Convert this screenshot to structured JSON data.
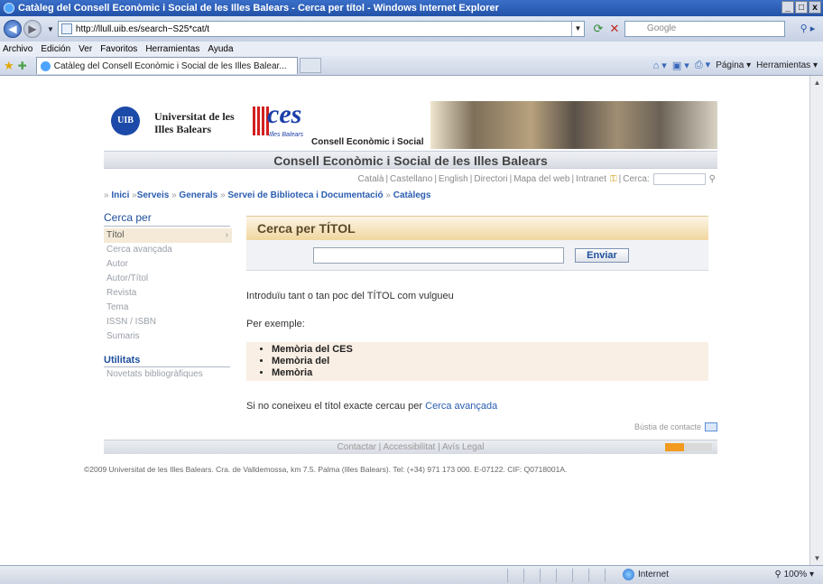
{
  "window": {
    "title": "Catàleg del Consell Econòmic i Social de les Illes Balears - Cerca per títol - Windows Internet Explorer",
    "controls": [
      "_",
      "□",
      "x"
    ]
  },
  "address": {
    "url": "http://llull.uib.es/search~S25*cat/t",
    "search_placeholder": "Google"
  },
  "menu": [
    "Archivo",
    "Edición",
    "Ver",
    "Favoritos",
    "Herramientas",
    "Ayuda"
  ],
  "tab": {
    "label": "Catàleg del Consell Econòmic i Social de les Illes Balear..."
  },
  "commandbar": {
    "page": "Página",
    "tools": "Herramientas"
  },
  "banner": {
    "uib_line1": "Universitat de les",
    "uib_line2": "Illes Balears",
    "uib_logo_text": "UIB",
    "ces_logo_text": "ces",
    "ces_logo_sub": "Illes Balears",
    "consell_label": "Consell Econòmic i Social",
    "title": "Consell Econòmic i Social de les Illes Balears"
  },
  "langbar": {
    "items": [
      "Català",
      "Castellano",
      "English",
      "Directori",
      "Mapa del web",
      "Intranet"
    ],
    "search_label": "Cerca:"
  },
  "breadcrumb": [
    "Inici",
    "Serveis",
    "Generals",
    "Servei de Biblioteca i Documentació",
    "Catàlegs"
  ],
  "sidebar": {
    "heading": "Cerca per",
    "items": [
      "Títol",
      "Cerca avançada",
      "Autor",
      "Autor/Títol",
      "Revista",
      "Tema",
      "ISSN / ISBN",
      "Sumaris"
    ],
    "active_index": 0,
    "heading2": "Utilitats",
    "items2": [
      "Novetats bibliogràfiques"
    ]
  },
  "main": {
    "panel_title": "Cerca per TÍTOL",
    "search_value": "",
    "submit_label": "Enviar",
    "intro": "Introduïu tant o tan poc del TÍTOL com vulgueu",
    "example_label": "Per exemple:",
    "examples": [
      "Memòria del CES",
      "Memòria del",
      "Memòria"
    ],
    "footnote_prefix": "Si no coneixeu el títol exacte cercau per",
    "footnote_link": "Cerca avançada"
  },
  "contact": {
    "label": "Bústia de contacte"
  },
  "footer": {
    "links": [
      "Contactar",
      "Accessibilitat",
      "Avís Legal"
    ],
    "copyright": "©2009 Universitat de les Illes Balears. Cra. de Valldemossa, km 7.5. Palma (Illes Balears). Tel: (+34) 971 173 000. E-07122. CIF: Q0718001A."
  },
  "statusbar": {
    "zone": "Internet",
    "zoom": "100%"
  }
}
